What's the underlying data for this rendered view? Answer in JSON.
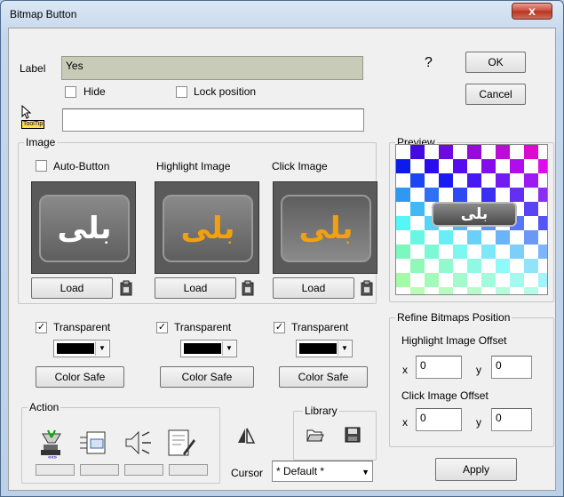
{
  "window": {
    "title": "Bitmap Button",
    "close_glyph": "x"
  },
  "general": {
    "label_caption": "Label",
    "label_value": "Yes",
    "hide_label": "Hide",
    "lock_position_label": "Lock position",
    "tooltip_badge": "ToolTip",
    "tooltip_value": "",
    "help_glyph": "?",
    "ok_label": "OK",
    "cancel_label": "Cancel"
  },
  "image_group": {
    "title": "Image",
    "auto_button_label": "Auto-Button",
    "highlight_caption": "Highlight Image",
    "click_caption": "Click Image",
    "button_glyph": "بلی",
    "columns": [
      {
        "load": "Load",
        "transparent": "Transparent",
        "color_safe": "Color Safe",
        "text_color": "#ffffff"
      },
      {
        "load": "Load",
        "transparent": "Transparent",
        "color_safe": "Color Safe",
        "text_color": "#f0a010"
      },
      {
        "load": "Load",
        "transparent": "Transparent",
        "color_safe": "Color Safe",
        "text_color": "#f0a010"
      }
    ],
    "check_glyph": "✓"
  },
  "preview": {
    "title": "Preview",
    "button_glyph": "بلی"
  },
  "refine": {
    "title": "Refine Bitmaps Position",
    "highlight_caption": "Highlight Image Offset",
    "click_caption": "Click Image Offset",
    "x_label": "x",
    "y_label": "y",
    "highlight_x": "0",
    "highlight_y": "0",
    "click_x": "0",
    "click_y": "0"
  },
  "apply_label": "Apply",
  "action": {
    "title": "Action"
  },
  "library": {
    "title": "Library"
  },
  "cursor": {
    "label": "Cursor",
    "value": "* Default *"
  },
  "colors": {
    "title_bg": "#c5d7ec",
    "close_red": "#c9463a",
    "image_text_white": "#ffffff",
    "image_text_orange": "#f0a010"
  }
}
